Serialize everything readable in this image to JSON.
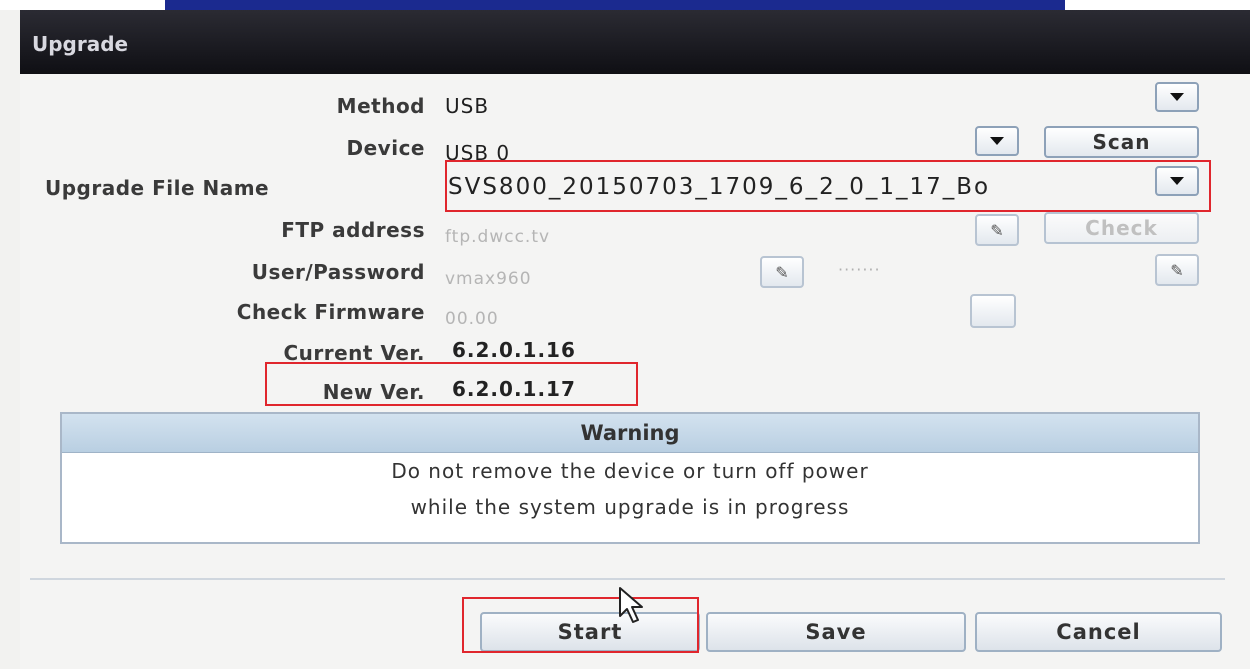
{
  "window": {
    "title": "Upgrade"
  },
  "form": {
    "method": {
      "label": "Method",
      "value": "USB"
    },
    "device": {
      "label": "Device",
      "value": "USB 0",
      "scan_label": "Scan"
    },
    "upgrade_file": {
      "label": "Upgrade File Name",
      "value": "SVS800_20150703_1709_6_2_0_1_17_Bo"
    },
    "ftp_address": {
      "label": "FTP address",
      "value": "ftp.dwcc.tv",
      "check_label": "Check"
    },
    "user_password": {
      "label": "User/Password",
      "user": "vmax960",
      "password": "·······"
    },
    "check_firmware": {
      "label": "Check Firmware",
      "value": "00.00"
    },
    "current_ver": {
      "label": "Current Ver.",
      "value": "6.2.0.1.16"
    },
    "new_ver": {
      "label": "New Ver.",
      "value": "6.2.0.1.17"
    }
  },
  "warning": {
    "title": "Warning",
    "line1": "Do not remove the device or turn off power",
    "line2": "while the system upgrade is in progress"
  },
  "buttons": {
    "start": "Start",
    "save": "Save",
    "cancel": "Cancel"
  },
  "icons": {
    "dropdown": "chevron-down-icon",
    "edit": "pencil-icon",
    "cursor": "mouse-pointer-icon"
  },
  "colors": {
    "highlight": "#e0262d",
    "titlebar": "#1a1a22",
    "warning_header": "#c5d8ea"
  }
}
